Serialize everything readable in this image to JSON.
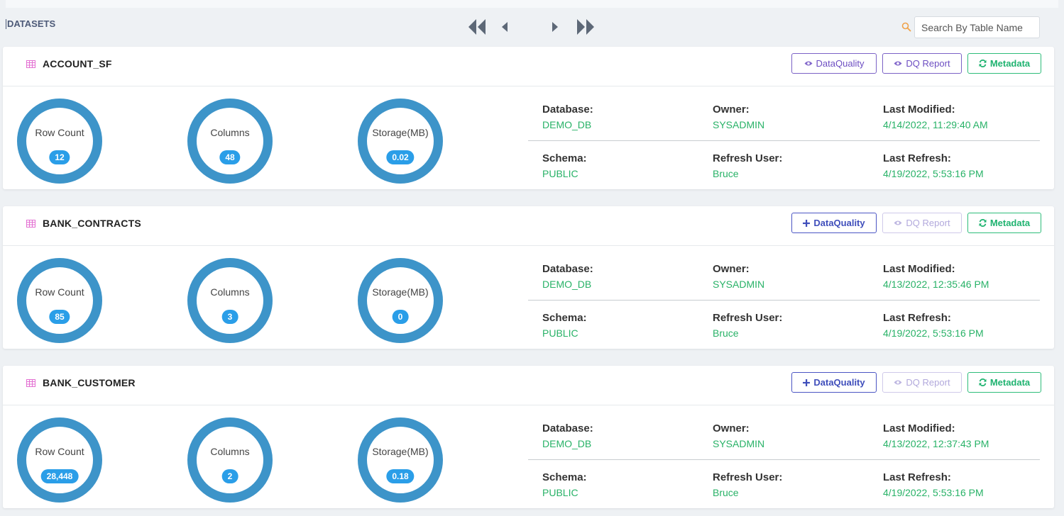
{
  "page": {
    "title": "DATASETS"
  },
  "search": {
    "placeholder": "Search By Table Name"
  },
  "labels": {
    "row_count": "Row Count",
    "columns": "Columns",
    "storage": "Storage(MB)",
    "database": "Database:",
    "owner": "Owner:",
    "last_modified": "Last Modified:",
    "schema": "Schema:",
    "refresh_user": "Refresh User:",
    "last_refresh": "Last Refresh:",
    "dataquality": "DataQuality",
    "dq_report": "DQ Report",
    "metadata": "Metadata"
  },
  "colors": {
    "ring": "#3d94c9",
    "badge": "#2a9ee8",
    "value_green": "#28b267",
    "accent_purple": "#6d4ec2",
    "meta_green": "#1fb370"
  },
  "datasets": [
    {
      "name": "ACCOUNT_SF",
      "row_count": "12",
      "columns": "48",
      "storage": "0.02",
      "database": "DEMO_DB",
      "owner": "SYSADMIN",
      "last_modified": "4/14/2022, 11:29:40 AM",
      "schema": "PUBLIC",
      "refresh_user": "Bruce",
      "last_refresh": "4/19/2022, 5:53:16 PM",
      "dq_mode": "view",
      "dq_report_enabled": true
    },
    {
      "name": "BANK_CONTRACTS",
      "row_count": "85",
      "columns": "3",
      "storage": "0",
      "database": "DEMO_DB",
      "owner": "SYSADMIN",
      "last_modified": "4/13/2022, 12:35:46 PM",
      "schema": "PUBLIC",
      "refresh_user": "Bruce",
      "last_refresh": "4/19/2022, 5:53:16 PM",
      "dq_mode": "add",
      "dq_report_enabled": false
    },
    {
      "name": "BANK_CUSTOMER",
      "row_count": "28,448",
      "columns": "2",
      "storage": "0.18",
      "database": "DEMO_DB",
      "owner": "SYSADMIN",
      "last_modified": "4/13/2022, 12:37:43 PM",
      "schema": "PUBLIC",
      "refresh_user": "Bruce",
      "last_refresh": "4/19/2022, 5:53:16 PM",
      "dq_mode": "add",
      "dq_report_enabled": false
    }
  ]
}
